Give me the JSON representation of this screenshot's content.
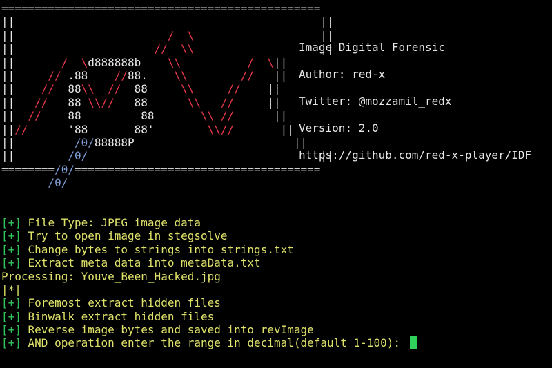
{
  "banner": {
    "lines": [
      [
        {
          "c": "w",
          "t": "================================================"
        }
      ],
      [
        {
          "c": "w",
          "t": "||"
        },
        {
          "c": "r",
          "t": "                         __                   "
        },
        {
          "c": "w",
          "t": "||"
        }
      ],
      [
        {
          "c": "w",
          "t": "||"
        },
        {
          "c": "r",
          "t": "                       /  \\                   "
        },
        {
          "c": "w",
          "t": "||"
        }
      ],
      [
        {
          "c": "w",
          "t": "||"
        },
        {
          "c": "r",
          "t": "         __          //  \\\\           __      "
        },
        {
          "c": "w",
          "t": "||"
        }
      ],
      [
        {
          "c": "w",
          "t": "||"
        },
        {
          "c": "r",
          "t": "       /  \\"
        },
        {
          "c": "w",
          "t": "d888888b"
        },
        {
          "c": "r",
          "t": "    \\\\          /  \\"
        },
        {
          "c": "w",
          "t": "||"
        }
      ],
      [
        {
          "c": "w",
          "t": "||"
        },
        {
          "c": "r",
          "t": "     //"
        },
        {
          "c": "w",
          "t": " .88    "
        },
        {
          "c": "r",
          "t": "//"
        },
        {
          "c": "w",
          "t": "88."
        },
        {
          "c": "r",
          "t": "    \\\\        //   "
        },
        {
          "c": "w",
          "t": "||"
        }
      ],
      [
        {
          "c": "w",
          "t": "||"
        },
        {
          "c": "r",
          "t": "    //  "
        },
        {
          "c": "w",
          "t": "88"
        },
        {
          "c": "r",
          "t": "\\\\  //"
        },
        {
          "c": "w",
          "t": "  88"
        },
        {
          "c": "r",
          "t": "     \\\\     //    "
        },
        {
          "c": "w",
          "t": "||"
        }
      ],
      [
        {
          "c": "w",
          "t": "||"
        },
        {
          "c": "r",
          "t": "   //   "
        },
        {
          "c": "w",
          "t": "88"
        },
        {
          "c": "r",
          "t": " \\\\//"
        },
        {
          "c": "w",
          "t": "   88"
        },
        {
          "c": "r",
          "t": "      \\\\   //     "
        },
        {
          "c": "w",
          "t": "||"
        }
      ],
      [
        {
          "c": "w",
          "t": "||"
        },
        {
          "c": "r",
          "t": "  //    "
        },
        {
          "c": "w",
          "t": "88         88"
        },
        {
          "c": "r",
          "t": "       \\\\ //      "
        },
        {
          "c": "w",
          "t": "||"
        }
      ],
      [
        {
          "c": "w",
          "t": "||"
        },
        {
          "c": "r",
          "t": "//      "
        },
        {
          "c": "w",
          "t": "'88       88'"
        },
        {
          "c": "r",
          "t": "        \\\\//       "
        },
        {
          "c": "w",
          "t": "||"
        }
      ],
      [
        {
          "c": "w",
          "t": "||"
        },
        {
          "c": "b",
          "t": "         /0/"
        },
        {
          "c": "w",
          "t": "88888P                        "
        },
        {
          "c": "w",
          "t": "||"
        }
      ],
      [
        {
          "c": "w",
          "t": "||"
        },
        {
          "c": "b",
          "t": "        /0/                                   "
        },
        {
          "c": "w",
          "t": "||"
        }
      ],
      [
        {
          "c": "w",
          "t": "========"
        },
        {
          "c": "b",
          "t": "/0/"
        },
        {
          "c": "w",
          "t": "====================================="
        }
      ],
      [
        {
          "c": "b",
          "t": "       /0/"
        }
      ]
    ]
  },
  "info": {
    "title": "Image Digital Forensic",
    "author": "Author: red-x",
    "twitter": "Twitter: @mozzamil_redx",
    "version": "Version: 2.0",
    "url": "https://github.com/red-x-player/IDF"
  },
  "output": {
    "prefix": "[+]",
    "lines": [
      {
        "prefix": true,
        "text": " File Type: JPEG image data"
      },
      {
        "prefix": true,
        "text": " Try to open image in stegsolve"
      },
      {
        "prefix": true,
        "text": " Change bytes to strings into strings.txt"
      },
      {
        "prefix": true,
        "text": " Extract meta data into metaData.txt"
      },
      {
        "prefix": false,
        "text": "Processing: Youve_Been_Hacked.jpg"
      },
      {
        "prefix": false,
        "text": "|*|"
      },
      {
        "prefix": true,
        "text": " Foremost extract hidden files"
      },
      {
        "prefix": true,
        "text": " Binwalk extract hidden files"
      },
      {
        "prefix": true,
        "text": " Reverse image bytes and saved into revImage"
      },
      {
        "prefix": true,
        "text": " AND operation enter the range in decimal(default 1-100): "
      }
    ]
  },
  "colors": {
    "background": "#000000",
    "text": "#e6e6e6",
    "art_red": "#e8394a",
    "art_blue": "#7f9fd8",
    "output_yellow": "#dfe26a",
    "prefix_green": "#2fc45b",
    "cursor": "#2fd15a"
  }
}
